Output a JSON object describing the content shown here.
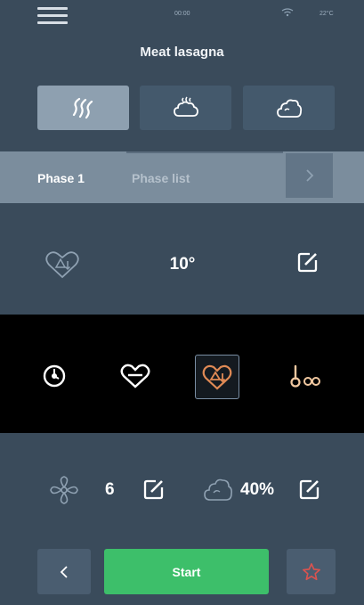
{
  "status": {
    "time": "00:00",
    "temperature": "22°C"
  },
  "header": {
    "title": "Meat lasagna"
  },
  "cooking_modes": [
    {
      "name": "convection",
      "active": true
    },
    {
      "name": "combi",
      "active": false
    },
    {
      "name": "steam",
      "active": false
    }
  ],
  "phase": {
    "current_label": "Phase 1",
    "list_label": "Phase list"
  },
  "probe": {
    "delta_temperature": "10°"
  },
  "function_icons": [
    "timer-icon",
    "core-probe-icon",
    "delta-t-icon",
    "multipoint-probe-icon"
  ],
  "fan": {
    "speed": "6"
  },
  "humidity": {
    "value": "40%"
  },
  "footer": {
    "start_label": "Start"
  },
  "colors": {
    "background": "#3a4b5b",
    "accent_green": "#3dbf6a",
    "accent_orange": "#e08a55",
    "favorite_red": "#d9534f"
  }
}
